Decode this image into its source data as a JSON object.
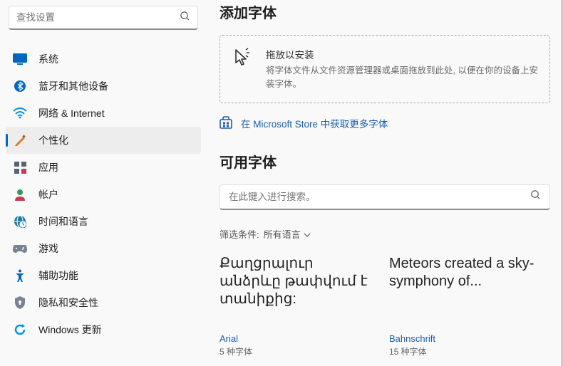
{
  "sidebar": {
    "search_placeholder": "查找设置",
    "items": [
      {
        "label": "系统",
        "icon": "system-icon",
        "active": false
      },
      {
        "label": "蓝牙和其他设备",
        "icon": "bluetooth-icon",
        "active": false
      },
      {
        "label": "网络 & Internet",
        "icon": "wifi-icon",
        "active": false
      },
      {
        "label": "个性化",
        "icon": "personalize-icon",
        "active": true
      },
      {
        "label": "应用",
        "icon": "apps-icon",
        "active": false
      },
      {
        "label": "帐户",
        "icon": "accounts-icon",
        "active": false
      },
      {
        "label": "时间和语言",
        "icon": "time-lang-icon",
        "active": false
      },
      {
        "label": "游戏",
        "icon": "gaming-icon",
        "active": false
      },
      {
        "label": "辅助功能",
        "icon": "accessibility-icon",
        "active": false
      },
      {
        "label": "隐私和安全性",
        "icon": "privacy-icon",
        "active": false
      },
      {
        "label": "Windows 更新",
        "icon": "update-icon",
        "active": false
      }
    ]
  },
  "main": {
    "add_fonts_title": "添加字体",
    "drop_title": "拖放以安装",
    "drop_sub": "将字体文件从文件资源管理器或桌面拖放到此处, 以便在你的设备上安装字体。",
    "store_link": "在 Microsoft Store 中获取更多字体",
    "available_fonts_title": "可用字体",
    "font_search_placeholder": "在此键入进行搜索。",
    "filter_label": "筛选条件:",
    "filter_value": "所有语言",
    "font_cards": [
      {
        "preview": "Քաղցրալուր անձրևը թափվում է տանիքից:",
        "name": "Arial",
        "count": "5 种字体"
      },
      {
        "preview": "Meteors created a sky-symphony of...",
        "name": "Bahnschrift",
        "count": "15 种字体"
      }
    ]
  }
}
